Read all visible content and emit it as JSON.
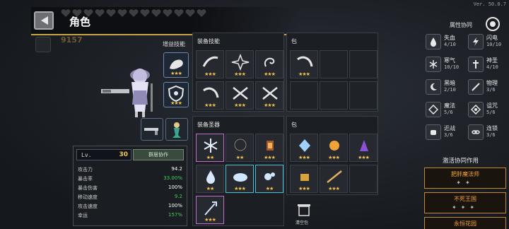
{
  "header": {
    "title": "角色",
    "version": "Ver. 50.0.7",
    "gold": "9157",
    "attr_title": "属性协同"
  },
  "character": {
    "boost_skill_label": "增益技能",
    "level_label": "Lv.",
    "level": "30",
    "team_button": "群居协作",
    "stats": [
      {
        "label": "攻击力",
        "value": "94.2",
        "highlight": false
      },
      {
        "label": "暴击率",
        "value": "33.00%",
        "highlight": true
      },
      {
        "label": "暴击伤害",
        "value": "100%",
        "highlight": false
      },
      {
        "label": "移动速度",
        "value": "9.2",
        "highlight": true
      },
      {
        "label": "攻击速度",
        "value": "100%",
        "highlight": false
      },
      {
        "label": "幸运",
        "value": "157%",
        "highlight": true
      }
    ]
  },
  "equipped_skills": {
    "title": "装备技能",
    "items": [
      {
        "icon": "slash-icon",
        "stars": "★★★"
      },
      {
        "icon": "burst-icon",
        "stars": "★★★"
      },
      {
        "icon": "swirl-icon",
        "stars": "★★★"
      },
      {
        "icon": "arc-icon",
        "stars": "★★★"
      },
      {
        "icon": "sword-cross-icon",
        "stars": "★★★"
      },
      {
        "icon": "sword-cross-icon",
        "stars": "★★★"
      }
    ]
  },
  "bag_top": {
    "title": "包",
    "items": [
      {
        "icon": "arc-icon",
        "stars": "★★★"
      }
    ]
  },
  "equipped_relics": {
    "title": "装备圣器",
    "items": [
      {
        "icon": "snowflake-icon",
        "stars": "★★"
      },
      {
        "icon": "ring-icon",
        "stars": "★★"
      },
      {
        "icon": "lantern-icon",
        "stars": "★★★"
      },
      {
        "icon": "drop-icon",
        "stars": "★★"
      },
      {
        "icon": "cloud-icon",
        "stars": "★★★"
      },
      {
        "icon": "bubble-icon",
        "stars": "★★"
      },
      {
        "icon": "trident-icon",
        "stars": "★★★"
      }
    ]
  },
  "bag_bottom": {
    "title": "包",
    "items": [
      {
        "icon": "crystal-icon",
        "stars": "★★★"
      },
      {
        "icon": "fire-orb-icon",
        "stars": "★★★"
      },
      {
        "icon": "purple-shard-icon",
        "stars": "★★★"
      },
      {
        "icon": "box-icon",
        "stars": "★★★"
      },
      {
        "icon": "spear-icon",
        "stars": "★★★"
      }
    ],
    "trash_label": "清空包"
  },
  "attributes": [
    {
      "name": "失血",
      "value": "4/10",
      "icon": "blood-icon"
    },
    {
      "name": "闪电",
      "value": "10/10",
      "icon": "lightning-icon"
    },
    {
      "name": "寒气",
      "value": "10/10",
      "icon": "frost-icon"
    },
    {
      "name": "神圣",
      "value": "4/10",
      "icon": "holy-icon"
    },
    {
      "name": "黑暗",
      "value": "2/10",
      "icon": "dark-icon"
    },
    {
      "name": "物理",
      "value": "3/6",
      "icon": "physical-icon"
    },
    {
      "name": "魔法",
      "value": "5/6",
      "icon": "magic-icon"
    },
    {
      "name": "诅咒",
      "value": "5/6",
      "icon": "curse-icon"
    },
    {
      "name": "近战",
      "value": "3/6",
      "icon": "melee-icon"
    },
    {
      "name": "连锁",
      "value": "3/6",
      "icon": "chain-icon"
    }
  ],
  "synergy": {
    "title": "激活协同作用",
    "cards": [
      {
        "name": "肥胖魔法师"
      },
      {
        "name": "不死王国"
      },
      {
        "name": "永恒花园"
      }
    ]
  },
  "colors": {
    "accent_gold": "#c9a348",
    "star": "#f3c14b",
    "stat_green": "#3fd25a",
    "synergy_orange": "#f2a33a"
  }
}
